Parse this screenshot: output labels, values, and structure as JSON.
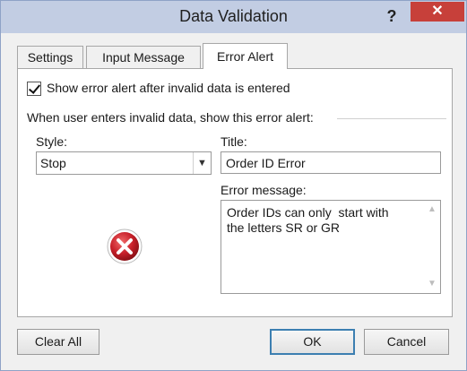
{
  "window": {
    "title": "Data Validation",
    "help_label": "?",
    "close_label": "✕"
  },
  "tabs": [
    {
      "label": "Settings",
      "active": false
    },
    {
      "label": "Input Message",
      "active": false
    },
    {
      "label": "Error Alert",
      "active": true
    }
  ],
  "error_alert": {
    "show_alert_label": "Show error alert after invalid data is entered",
    "show_alert_checked": true,
    "group_label": "When user enters invalid data, show this error alert:",
    "style_label": "Style:",
    "style_value": "Stop",
    "title_label": "Title:",
    "title_value": "Order ID Error",
    "message_label": "Error message:",
    "message_value": "Order IDs can only  start with\nthe letters SR or GR",
    "icon": "error-stop-icon"
  },
  "buttons": {
    "clear_all": "Clear All",
    "ok": "OK",
    "cancel": "Cancel"
  },
  "colors": {
    "titlebar": "#c2cde3",
    "close_button": "#c7403a",
    "error_icon": "#c8202a",
    "ok_focus_border": "#3c7fb1"
  }
}
